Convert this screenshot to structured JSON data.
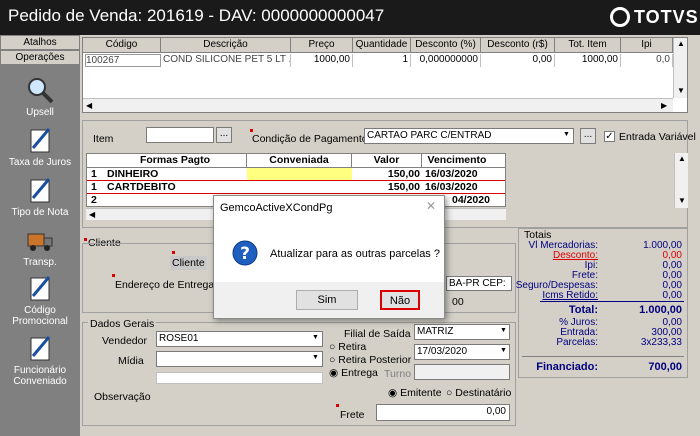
{
  "window": {
    "title": "Pedido de Venda: 201619  - DAV: 0000000000047",
    "logo": "TOTVS"
  },
  "sidebar": {
    "tabs": [
      "Atalhos",
      "Operações"
    ],
    "items": [
      {
        "label": "Upsell",
        "icon": "magnifier-icon"
      },
      {
        "label": "Taxa de Juros",
        "icon": "pen-paper-icon"
      },
      {
        "label": "Tipo de Nota",
        "icon": "pen-paper-icon"
      },
      {
        "label": "Transp.",
        "icon": "truck-icon"
      },
      {
        "label": "Código Promocional",
        "icon": "pen-paper-icon"
      },
      {
        "label": "Funcionário Conveniado",
        "icon": "pen-paper-icon"
      }
    ]
  },
  "items_grid": {
    "headers": [
      "Código",
      "Descrição",
      "Preço",
      "Quantidade",
      "Desconto (%)",
      "Desconto (r$)",
      "Tot. Item",
      "Ipi"
    ],
    "row": [
      "100267",
      "COND SILICONE PET 5 LT . . .",
      "1000,00",
      "1",
      "0,000000000",
      "0,00",
      "1000,00",
      "0,0"
    ]
  },
  "payment": {
    "item_label": "Item",
    "cond_label": "Condição de Pagamento",
    "cond_value": "CARTAO PARC C/ENTRAD",
    "entrada_label": "Entrada Variável",
    "headers": [
      "Formas Pagto",
      "Conveniada",
      "Valor",
      "Vencimento"
    ],
    "rows": [
      {
        "n": "1",
        "forma": "DINHEIRO",
        "valor": "150,00",
        "venc": "16/03/2020"
      },
      {
        "n": "1",
        "forma": "CARTDEBITO",
        "valor": "150,00",
        "venc": "16/03/2020"
      },
      {
        "n": "2",
        "forma": "",
        "valor": "",
        "venc": "04/2020"
      }
    ]
  },
  "cliente": {
    "section": "Cliente",
    "cliente_label": "Cliente",
    "endereco_label": "Endereço de Entrega",
    "cep": "BA-PR CEP:",
    "valor": "00"
  },
  "dados": {
    "section": "Dados Gerais",
    "vendedor_label": "Vendedor",
    "vendedor": "ROSE01",
    "midia_label": "Mídia",
    "obs_label": "Observação",
    "filial_label": "Filial de Saída",
    "filial": "MATRIZ",
    "retira": "Retira",
    "retira_post": "Retira Posterior",
    "entrega": "Entrega",
    "data": "17/03/2020",
    "turno": "Turno",
    "emitente": "Emitente",
    "destinatario": "Destinatário",
    "frete_label": "Frete",
    "frete": "0,00"
  },
  "totais": {
    "section": "Totais",
    "rows": [
      {
        "l": "Vl Mercadorias:",
        "v": "1.000,00"
      },
      {
        "l": "Desconto:",
        "v": "0,00"
      },
      {
        "l": "Ipi:",
        "v": "0,00"
      },
      {
        "l": "Frete:",
        "v": "0,00"
      },
      {
        "l": "Seguro/Despesas:",
        "v": "0,00"
      },
      {
        "l": "Icms Retido:",
        "v": "0,00"
      }
    ],
    "total_l": "Total:",
    "total_v": "1.000,00",
    "juros_l": "% Juros:",
    "juros_v": "0,00",
    "entrada_l": "Entrada:",
    "entrada_v": "300,00",
    "parcelas_l": "Parcelas:",
    "parcelas_v": "3x233,33",
    "financiado_l": "Financiado:",
    "financiado_v": "700,00"
  },
  "dialog": {
    "title": "GemcoActiveXCondPg",
    "message": "Atualizar para as outras parcelas ?",
    "yes": "Sim",
    "no": "Não"
  }
}
